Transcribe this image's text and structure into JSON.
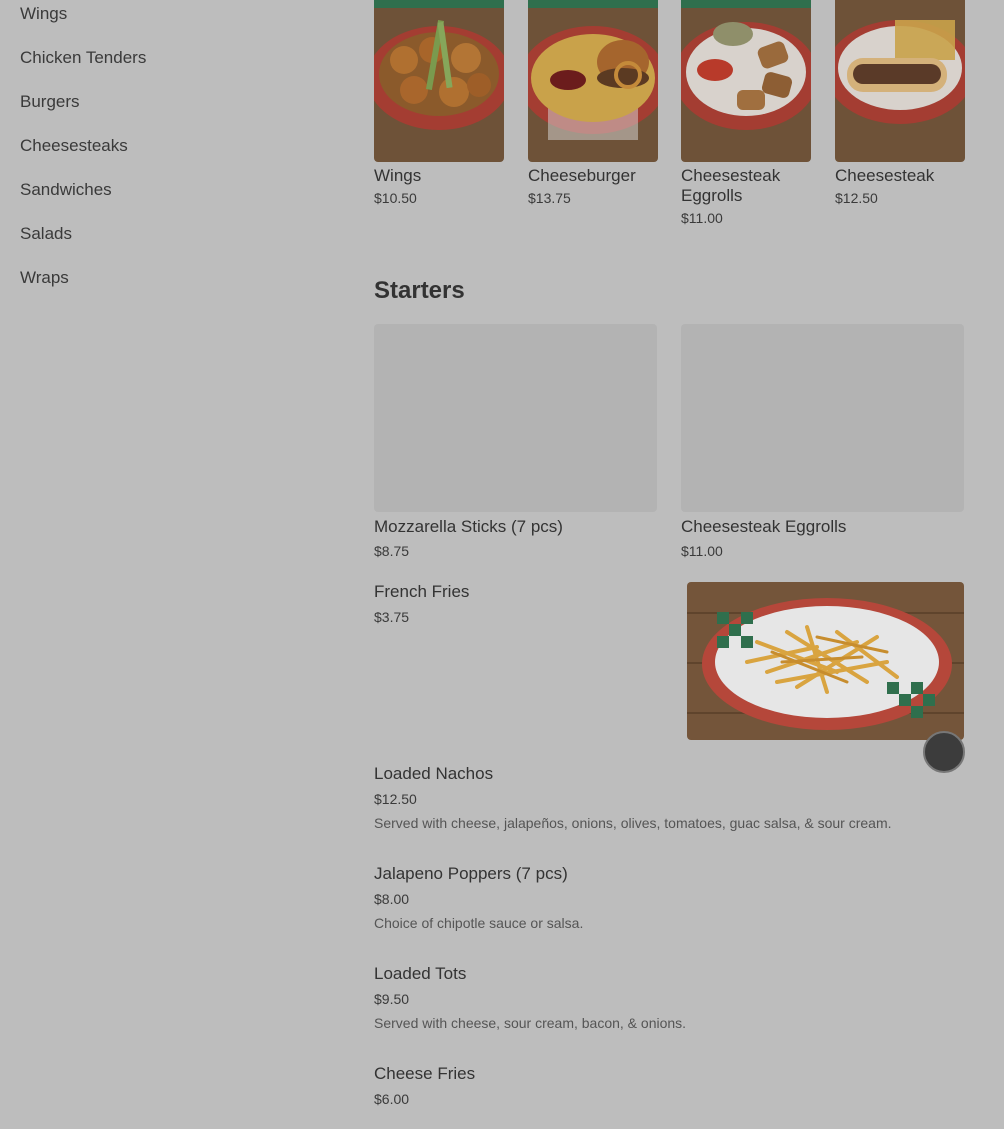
{
  "sidebar": {
    "items": [
      {
        "label": "Wings"
      },
      {
        "label": "Chicken Tenders"
      },
      {
        "label": "Burgers"
      },
      {
        "label": "Cheesesteaks"
      },
      {
        "label": "Sandwiches"
      },
      {
        "label": "Salads"
      },
      {
        "label": "Wraps"
      }
    ]
  },
  "featured": [
    {
      "name": "Wings",
      "price": "$10.50"
    },
    {
      "name": "Cheeseburger",
      "price": "$13.75"
    },
    {
      "name": "Cheesesteak Eggrolls",
      "price": "$11.00"
    },
    {
      "name": "Cheesesteak",
      "price": "$12.50"
    }
  ],
  "starters": {
    "title": "Starters",
    "grid": [
      {
        "name": "Mozzarella Sticks (7 pcs)",
        "price": "$8.75"
      },
      {
        "name": "Cheesesteak Eggrolls",
        "price": "$11.00"
      }
    ],
    "items": [
      {
        "name": "French Fries",
        "price": "$3.75",
        "description": ""
      },
      {
        "name": "Loaded Nachos",
        "price": "$12.50",
        "description": "Served with cheese, jalapeños, onions, olives, tomatoes, guac salsa, & sour cream."
      },
      {
        "name": "Jalapeno Poppers (7 pcs)",
        "price": "$8.00",
        "description": "Choice of chipotle sauce or salsa."
      },
      {
        "name": "Loaded Tots",
        "price": "$9.50",
        "description": "Served with cheese, sour cream, bacon, & onions."
      },
      {
        "name": "Cheese Fries",
        "price": "$6.00",
        "description": ""
      }
    ]
  },
  "colors": {
    "overlay": "#bdbdbd",
    "placeholder": "#b3b3b3",
    "basket": "#c4483a",
    "checker_green": "#2f6f4d",
    "wood": "#7a5a3c"
  },
  "icons": [
    "add-icon"
  ]
}
